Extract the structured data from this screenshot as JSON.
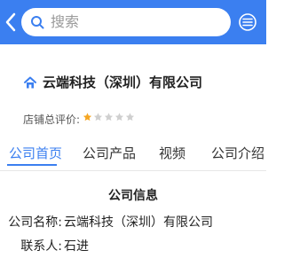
{
  "header": {
    "search_placeholder": "搜索",
    "accent_color": "#3b7ff0"
  },
  "company": {
    "name": "云端科技（深圳）有限公司",
    "rating_label": "店铺总评价:",
    "rating_stars": 1,
    "rating_max": 5
  },
  "tabs": [
    {
      "label": "公司首页",
      "active": true
    },
    {
      "label": "公司产品",
      "active": false
    },
    {
      "label": "视频",
      "active": false
    },
    {
      "label": "公司介绍",
      "active": false
    }
  ],
  "info": {
    "title": "公司信息",
    "rows": [
      {
        "label": "公司名称:",
        "value": "云端科技（深圳）有限公司"
      },
      {
        "label": "联系人:",
        "value": "石进"
      }
    ]
  },
  "icons": {
    "back": "chevron-left-icon",
    "search": "search-icon",
    "menu": "menu-icon",
    "home": "home-icon",
    "star": "star-icon"
  }
}
